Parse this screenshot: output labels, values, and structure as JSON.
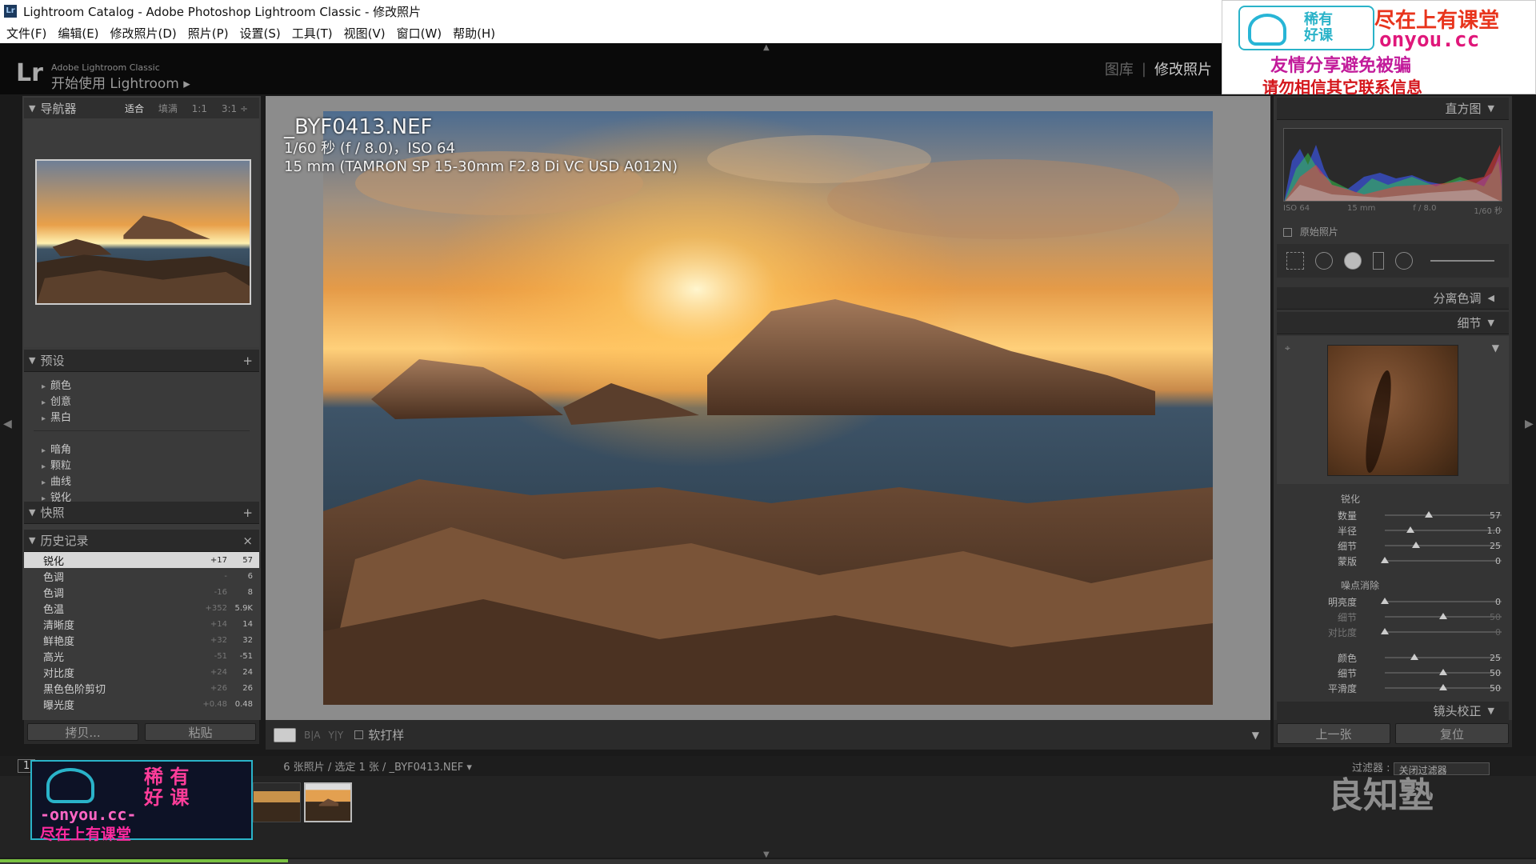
{
  "window": {
    "title": "Lightroom Catalog - Adobe Photoshop Lightroom Classic - 修改照片",
    "app_icon": "Lr"
  },
  "menu": [
    "文件(F)",
    "编辑(E)",
    "修改照片(D)",
    "照片(P)",
    "设置(S)",
    "工具(T)",
    "视图(V)",
    "窗口(W)",
    "帮助(H)"
  ],
  "identity": {
    "logo": "Lr",
    "product": "Adobe Lightroom Classic",
    "tagline": "开始使用 Lightroom ▸"
  },
  "modules": {
    "library": "图库",
    "separator": "|",
    "develop": "修改照片"
  },
  "ad": {
    "logo_line1": "稀有",
    "logo_line2": "好课",
    "line1": "尽在上有课堂",
    "line2": "onyou.cc",
    "line3": "友情分享避免被骗",
    "line4": "请勿相信其它联系信息"
  },
  "navigator": {
    "title": "导航器",
    "fit": "适合",
    "fill": "填满",
    "z1": "1:1",
    "z2": "3:1 ÷"
  },
  "presets": {
    "title": "预设",
    "add": "+",
    "items": [
      "颜色",
      "创意",
      "黑白",
      "暗角",
      "颗粒",
      "曲线",
      "锐化"
    ]
  },
  "snapshots": {
    "title": "快照",
    "add": "+"
  },
  "history": {
    "title": "历史记录",
    "clear": "×",
    "rows": [
      {
        "name": "锐化",
        "delta": "+17",
        "value": "57"
      },
      {
        "name": "色调",
        "delta": "-",
        "value": "6"
      },
      {
        "name": "色调",
        "delta": "-16",
        "value": "8"
      },
      {
        "name": "色温",
        "delta": "+352",
        "value": "5.9K"
      },
      {
        "name": "清晰度",
        "delta": "+14",
        "value": "14"
      },
      {
        "name": "鲜艳度",
        "delta": "+32",
        "value": "32"
      },
      {
        "name": "高光",
        "delta": "-51",
        "value": "-51"
      },
      {
        "name": "对比度",
        "delta": "+24",
        "value": "24"
      },
      {
        "name": "黑色色阶剪切",
        "delta": "+26",
        "value": "26"
      },
      {
        "name": "曝光度",
        "delta": "+0.48",
        "value": "0.48"
      }
    ]
  },
  "left_buttons": {
    "copy": "拷贝...",
    "paste": "粘贴"
  },
  "photo_info": {
    "filename": "_BYF0413.NEF",
    "exposure": "1/60 秒 (f / 8.0)，ISO 64",
    "lens": "15 mm (TAMRON SP 15-30mm F2.8 Di VC USD A012N)"
  },
  "toolbar": {
    "proof": "软打样",
    "ba1": "B|A",
    "ba2": "Y|Y"
  },
  "histogram": {
    "title": "直方图",
    "iso": "ISO 64",
    "focal": "15 mm",
    "aperture": "f / 8.0",
    "shutter": "1/60 秒",
    "original": "原始照片"
  },
  "panels": {
    "split_toning": "分离色调",
    "detail": "细节",
    "lens_correction": "镜头校正"
  },
  "sharpening": {
    "title": "锐化",
    "sliders": [
      {
        "label": "数量",
        "value": "57",
        "pos": 0.38
      },
      {
        "label": "半径",
        "value": "1.0",
        "pos": 0.22
      },
      {
        "label": "细节",
        "value": "25",
        "pos": 0.27
      },
      {
        "label": "蒙版",
        "value": "0",
        "pos": 0.0
      }
    ]
  },
  "noise": {
    "title": "噪点消除",
    "sliders": [
      {
        "label": "明亮度",
        "value": "0",
        "pos": 0.0
      },
      {
        "label": "细节",
        "value": "50",
        "pos": 0.5
      },
      {
        "label": "对比度",
        "value": "0",
        "pos": 0.0
      },
      {
        "label": "颜色",
        "value": "25",
        "pos": 0.25
      },
      {
        "label": "细节",
        "value": "50",
        "pos": 0.5
      },
      {
        "label": "平滑度",
        "value": "50",
        "pos": 0.5
      }
    ]
  },
  "right_buttons": {
    "prev": "上一张",
    "reset": "复位"
  },
  "filmstrip": {
    "page1": "1",
    "source": "6 张照片 / 选定 1 张 / _BYF0413.NEF ▾",
    "filter_label": "过滤器 :",
    "filter_value": "关闭过滤器"
  },
  "watermark": "良知塾",
  "promo": {
    "line1": "稀 有",
    "line2": "好 课",
    "url": "-onyou.cc-",
    "slogan": "尽在上有课堂"
  }
}
